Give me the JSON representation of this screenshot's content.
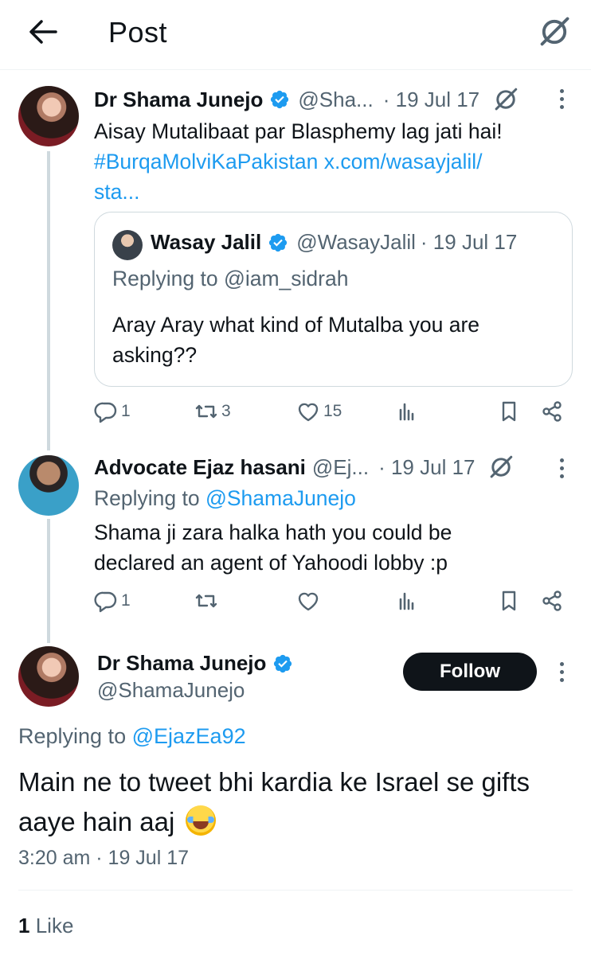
{
  "header": {
    "title": "Post",
    "back_icon": "back-arrow-icon",
    "grok_icon": "grok-icon"
  },
  "colors": {
    "link": "#1d9bf0",
    "verified": "#1d9bf0",
    "muted": "#536471",
    "text": "#0f1419",
    "follow_bg": "#0f1419"
  },
  "tweet1": {
    "name": "Dr Shama Junejo",
    "handle": "@Sha...",
    "date": "· 19 Jul 17",
    "text": "Aisay Mutalibaat par Blasphemy lag jati hai!",
    "hashtag": "#BurqaMolviKaPakistan",
    "link_part1": "x.com/wasayjalil/",
    "link_part2": "sta...",
    "quote": {
      "name": "Wasay Jalil",
      "handle": "@WasayJalil",
      "date": "· 19 Jul 17",
      "replying_prefix": "Replying to",
      "replying_handle": "@iam_sidrah",
      "text_line1": "Aray Aray what kind of Mutalba you are",
      "text_line2": "asking??"
    },
    "actions": {
      "replies": "1",
      "reposts": "3",
      "likes": "15"
    }
  },
  "tweet2": {
    "name": "Advocate Ejaz hasani",
    "handle": "@Ej...",
    "date": "· 19 Jul 17",
    "replying_prefix": "Replying to",
    "replying_handle": "@ShamaJunejo",
    "text_line1": "Shama ji zara halka hath you could be",
    "text_line2": "declared an agent of Yahoodi lobby :p",
    "actions": {
      "replies": "1"
    }
  },
  "main": {
    "name": "Dr Shama Junejo",
    "handle": "@ShamaJunejo",
    "follow_label": "Follow",
    "replying_prefix": "Replying to",
    "replying_handle": "@EjazEa92",
    "text_line1": "Main ne to tweet bhi kardia ke Israel se gifts",
    "text_line2": "aaye hain aaj",
    "emoji": "face-with-tears-of-joy",
    "timestamp": "3:20 am · 19 Jul 17",
    "like_count": "1",
    "like_label": "Like"
  }
}
